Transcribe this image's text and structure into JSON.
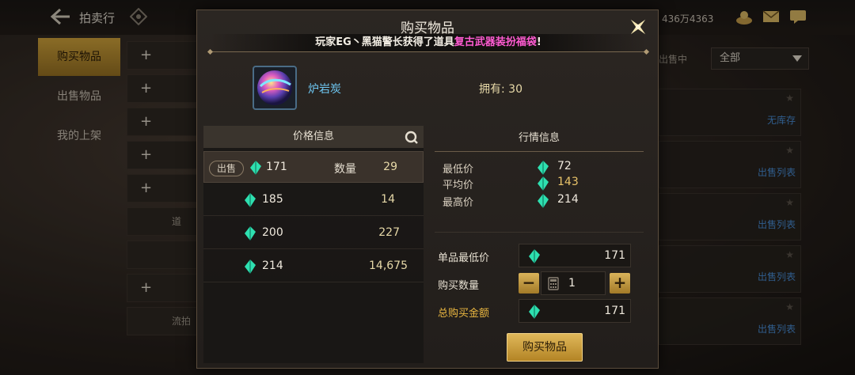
{
  "header": {
    "title": "拍卖行",
    "currency": "436万4363"
  },
  "sidebar": {
    "items": [
      {
        "label": "购买物品"
      },
      {
        "label": "出售物品"
      },
      {
        "label": "我的上架"
      }
    ]
  },
  "background": {
    "list_rows": [
      "+",
      "+",
      "+",
      "+",
      "+",
      "道",
      "",
      "+",
      "流拍"
    ],
    "filter_label": "出售中",
    "filter_value": "全部",
    "right_links": [
      "无库存",
      "出售列表",
      "出售列表",
      "出售列表",
      "出售列表"
    ]
  },
  "modal": {
    "title": "购买物品",
    "announcement": {
      "prefix": "玩家EG丶黑猫警长获得了道具",
      "item": "复古武器装扮福袋",
      "suffix": "!"
    },
    "item": {
      "name": "炉岩炭",
      "own_label": "拥有: 30"
    },
    "price_panel": {
      "header": "价格信息",
      "sell_tag": "出售",
      "qty_label": "数量",
      "rows": [
        {
          "price": "171",
          "qty": "29"
        },
        {
          "price": "185",
          "qty": "14"
        },
        {
          "price": "200",
          "qty": "227"
        },
        {
          "price": "214",
          "qty": "14,675"
        }
      ]
    },
    "market_panel": {
      "header": "行情信息",
      "min_label": "最低价",
      "min_value": "72",
      "avg_label": "平均价",
      "avg_value": "143",
      "max_label": "最高价",
      "max_value": "214"
    },
    "purchase": {
      "unit_label": "单品最低价",
      "unit_value": "171",
      "qty_label": "购买数量",
      "qty_value": "1",
      "minus": "−",
      "plus": "+",
      "total_label": "总购买金额",
      "total_value": "171",
      "buy_button": "购买物品"
    }
  },
  "colors": {
    "accent_gold": "#d4a63c",
    "highlight_pink": "#ff5bd2",
    "item_blue": "#6ec7f2",
    "gem_cyan": "#2ee0b0"
  }
}
